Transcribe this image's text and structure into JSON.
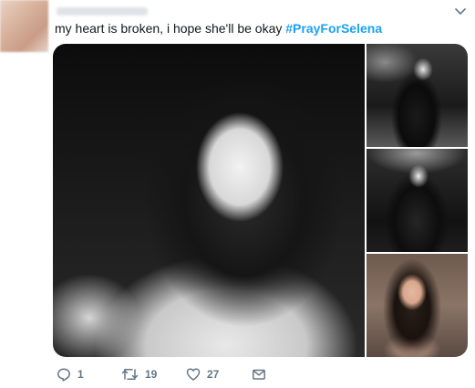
{
  "tweet": {
    "text": "my heart is broken, i hope she'll be okay",
    "hashtag": "#PrayForSelena"
  },
  "media": {
    "photos": [
      {
        "description_icon": "photo"
      },
      {
        "description_icon": "photo"
      },
      {
        "description_icon": "photo"
      },
      {
        "description_icon": "photo"
      }
    ]
  },
  "actions": {
    "reply_count": "1",
    "retweet_count": "19",
    "like_count": "27"
  },
  "colors": {
    "link": "#1da1f2",
    "muted": "#657786",
    "text": "#14171a"
  }
}
